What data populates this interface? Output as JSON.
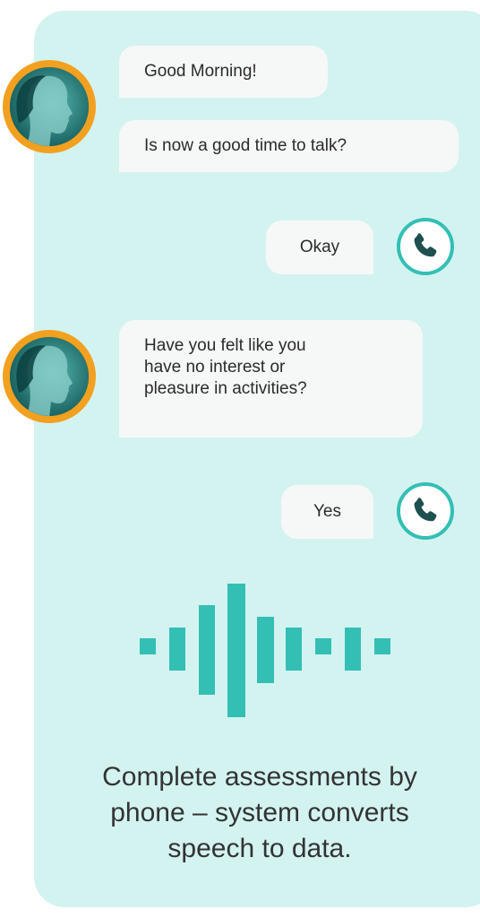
{
  "colors": {
    "panel_bg": "#d3f3f1",
    "bubble_bg": "#f6f8f7",
    "avatar_ring": "#f2a01f",
    "accent": "#33bfb4"
  },
  "messages": [
    {
      "sender": "agent",
      "text": "Good Morning!"
    },
    {
      "sender": "agent",
      "text": "Is now a good time to talk?"
    },
    {
      "sender": "user",
      "text": "Okay"
    },
    {
      "sender": "agent",
      "lines": [
        "Have you felt like you",
        "have no interest or",
        "pleasure in activities?"
      ]
    },
    {
      "sender": "user",
      "text": "Yes"
    }
  ],
  "icons": {
    "agent_avatar": "woman-profile-avatar",
    "user_avatar": "phone-icon",
    "waveform": "sound-wave-icon"
  },
  "caption": {
    "lines": [
      "Complete assessments by",
      "phone – system converts",
      "speech to data."
    ]
  }
}
